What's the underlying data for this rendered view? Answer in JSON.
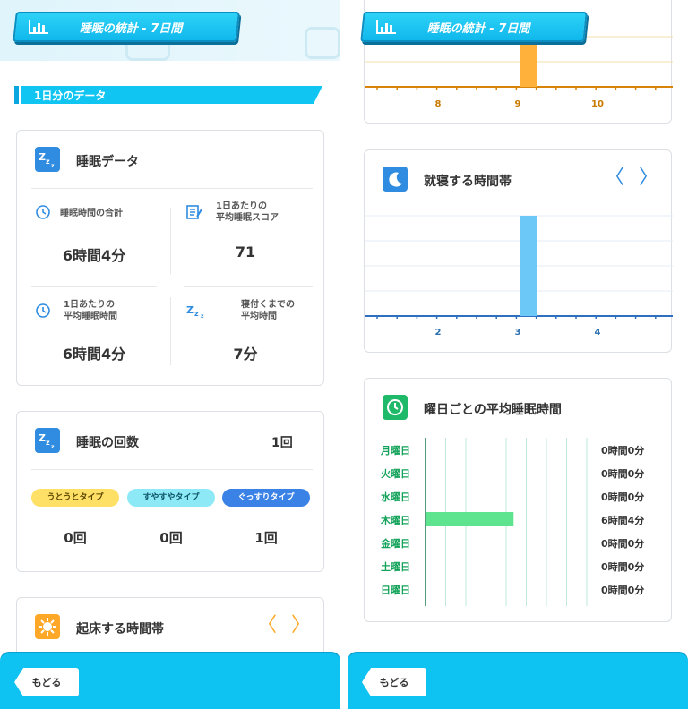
{
  "header": {
    "title": "睡眠の統計 - 7日間",
    "icon": "bar-chart-icon"
  },
  "section": {
    "title": "1日分のデータ"
  },
  "sleep_data": {
    "title": "睡眠データ",
    "total_label": "睡眠時間の合計",
    "total_value": "6時間4分",
    "score_label_1": "1日あたりの",
    "score_label_2": "平均睡眠スコア",
    "score_value": "71",
    "avg_label_1": "1日あたりの",
    "avg_label_2": "平均睡眠時間",
    "avg_value": "6時間4分",
    "fall_label_1": "寝付くまでの",
    "fall_label_2": "平均時間",
    "fall_value": "7分"
  },
  "sleep_count": {
    "title": "睡眠の回数",
    "count": "1回",
    "types": [
      {
        "label": "うとうとタイプ",
        "value": "0回",
        "color": "#ffe066"
      },
      {
        "label": "すやすやタイプ",
        "value": "0回",
        "color": "#8ee9f7"
      },
      {
        "label": "ぐっすりタイプ",
        "value": "1回",
        "color": "#3b82e6"
      }
    ]
  },
  "wake_time": {
    "title": "起床する時間帯",
    "prev": "〈",
    "next": "〉"
  },
  "wake_chart": {
    "ticks": [
      "8",
      "9",
      "10"
    ],
    "bar_color": "#ffb13b"
  },
  "bed_time": {
    "title": "就寝する時間帯",
    "prev": "〈",
    "next": "〉"
  },
  "bed_chart": {
    "ticks": [
      "2",
      "3",
      "4"
    ],
    "bar_color": "#6cc8f7"
  },
  "weekday": {
    "title": "曜日ごとの平均睡眠時間",
    "days": [
      {
        "day": "月曜日",
        "value": "0時間0分"
      },
      {
        "day": "火曜日",
        "value": "0時間0分"
      },
      {
        "day": "水曜日",
        "value": "0時間0分"
      },
      {
        "day": "木曜日",
        "value": "6時間4分"
      },
      {
        "day": "金曜日",
        "value": "0時間0分"
      },
      {
        "day": "土曜日",
        "value": "0時間0分"
      },
      {
        "day": "日曜日",
        "value": "0時間0分"
      }
    ],
    "bar_color": "#5ee38e"
  },
  "chart_data": [
    {
      "type": "bar",
      "categories": [
        "8",
        "9",
        "10"
      ],
      "values": [
        0,
        1,
        0
      ]
    },
    {
      "type": "bar",
      "categories": [
        "2",
        "3",
        "4"
      ],
      "values": [
        0,
        1,
        0
      ]
    },
    {
      "type": "bar",
      "categories": [
        "月曜日",
        "火曜日",
        "水曜日",
        "木曜日",
        "金曜日",
        "土曜日",
        "日曜日"
      ],
      "values": [
        0,
        0,
        0,
        364,
        0,
        0,
        0
      ]
    }
  ],
  "footer": {
    "back_label": "もどる"
  }
}
